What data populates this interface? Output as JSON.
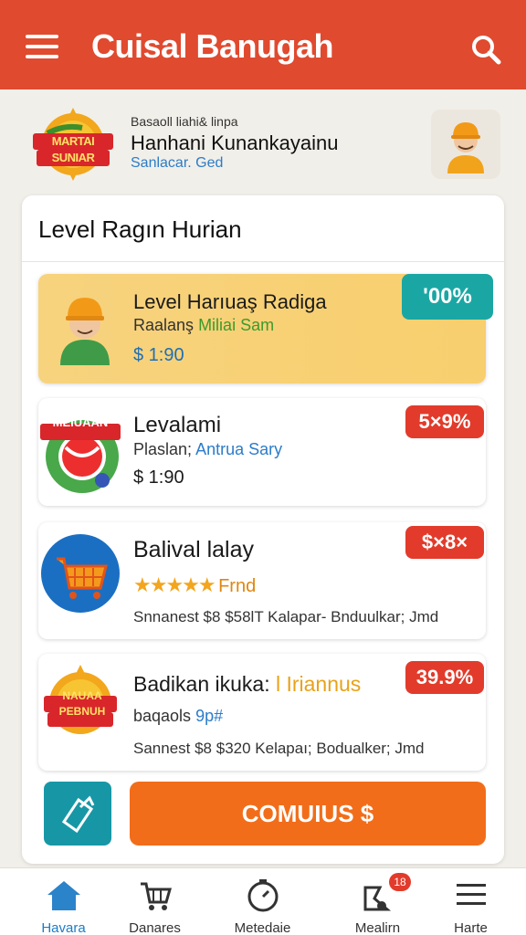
{
  "app": {
    "title": "Cuisal Banugah"
  },
  "profile": {
    "logo_text": "MARTAI SUNIAR",
    "subtitle": "Basaoll liahi& linpa",
    "name": "Hanhani Kunankayainu",
    "status": "Sanlacar. Ged"
  },
  "panel": {
    "title": "Level Ragın Hurian"
  },
  "cards": [
    {
      "title": "Level Harıuaş Radiga",
      "subtitle_a": "Raalanş",
      "subtitle_b": "Miliai Sam",
      "price": "$ 1:90",
      "badge": "'00%",
      "badge_color": "#1aa7a4"
    },
    {
      "title": "Levalami",
      "subtitle_a": "Plaslan;",
      "subtitle_b": "Antrua Sary",
      "price": "$ 1:90",
      "badge": "5×9%",
      "badge_color": "#e23b2b",
      "icon_text": "MEIUAAN"
    },
    {
      "title": "Balival lalay",
      "rating_text": "Frnd",
      "rating_stars": 5,
      "detail": "Snnanest $8 $58lT Kalapar- Bnduulkar; Jmd",
      "badge": "$×8×",
      "badge_color": "#e23b2b"
    },
    {
      "title_a": "Badikan ikuka:",
      "title_b": "l Iriannus",
      "subtitle_a": "baqaols",
      "subtitle_b": "9p#",
      "detail": "Sannest $8 $320 Kelapaı; Bodualker; Jmd",
      "badge": "39.9%",
      "badge_color": "#e23b2b",
      "icon_text": "NAUAA PEBNUH"
    }
  ],
  "cta": {
    "label": "COMUIUS $"
  },
  "nav": {
    "items": [
      {
        "label": "Havara",
        "icon": "home-icon",
        "active": true
      },
      {
        "label": "Danares",
        "icon": "cart-icon",
        "active": false
      },
      {
        "label": "Metedaie",
        "icon": "clock-icon",
        "active": false
      },
      {
        "label": "Mealirn",
        "icon": "notification-icon",
        "active": false
      },
      {
        "label": "Harte",
        "icon": "list-icon",
        "active": false
      }
    ],
    "notification_count": "18"
  },
  "colors": {
    "appbar": "#e04a2f",
    "accent": "#f26d1a",
    "teal": "#1797a6",
    "link": "#2b7cc9"
  }
}
